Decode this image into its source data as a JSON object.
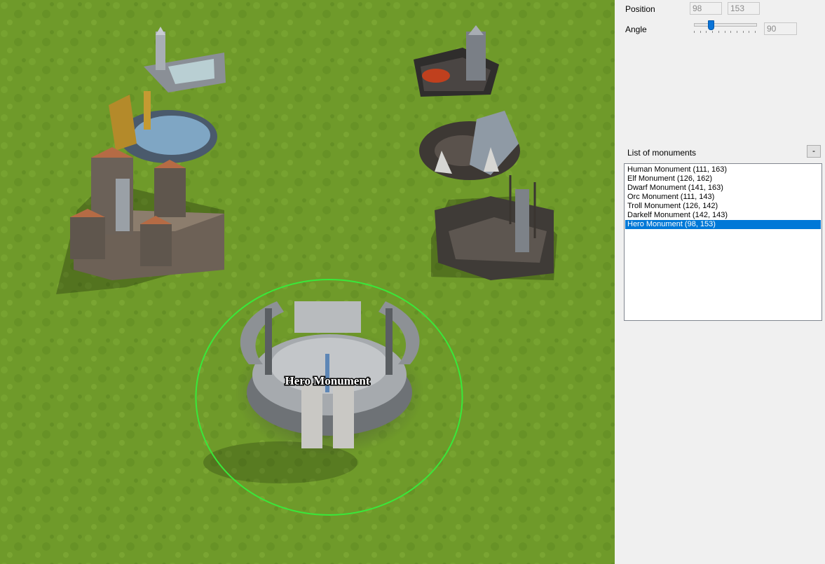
{
  "viewport": {
    "selected_label": "Hero Monument",
    "colors": {
      "grass": "#6f9a2a",
      "selection_ring": "#39e83a"
    }
  },
  "panel": {
    "position_label": "Position",
    "position_x": "98",
    "position_y": "153",
    "angle_label": "Angle",
    "angle_value": "90",
    "angle_slider_fraction": 0.25,
    "list_title": "List of monuments",
    "remove_button": "-",
    "monuments": [
      "Human Monument (111, 163)",
      "Elf Monument (126, 162)",
      "Dwarf Monument (141, 163)",
      "Orc Monument (111, 143)",
      "Troll Monument (126, 142)",
      "Darkelf Monument (142, 143)",
      "Hero Monument (98, 153)"
    ],
    "selected_index": 6,
    "colors": {
      "selection": "#0078d7",
      "slider_thumb": "#0a74d8"
    }
  }
}
